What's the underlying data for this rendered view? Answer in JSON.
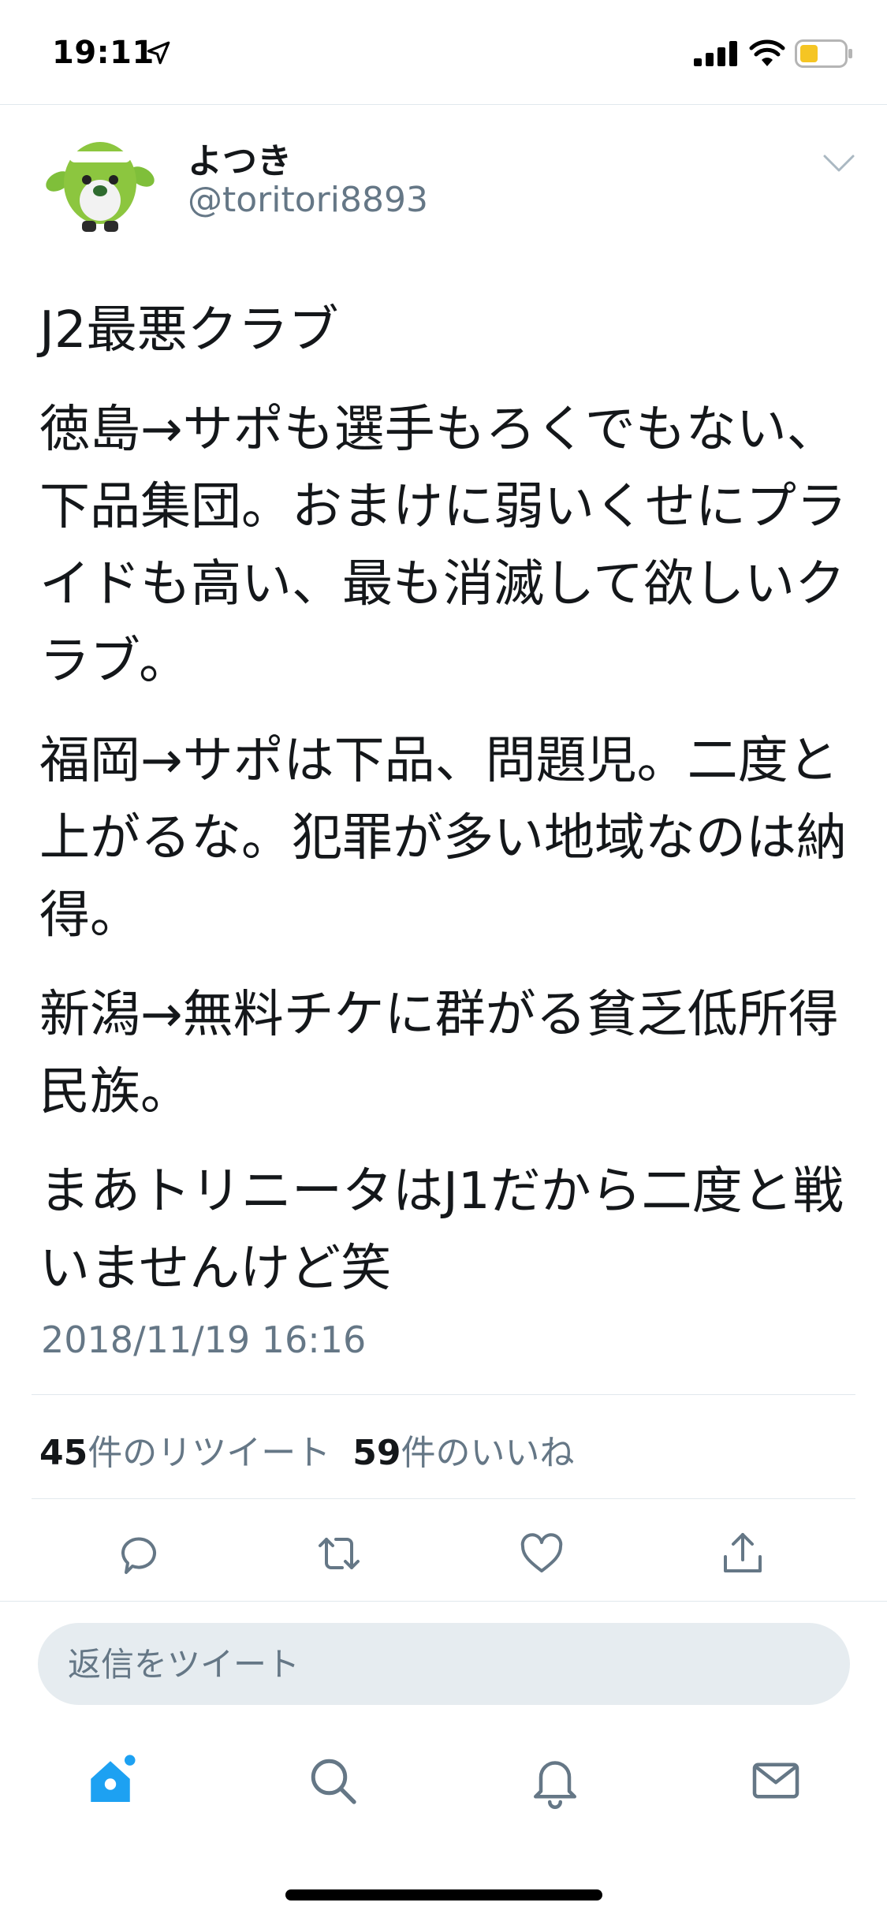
{
  "status_bar": {
    "time": "19:11",
    "icons": [
      "location-arrow-icon",
      "cellular-signal-icon",
      "wifi-icon",
      "battery-icon"
    ]
  },
  "tweet": {
    "display_name": "よつき",
    "handle": "@toritori8893",
    "paragraphs": [
      "J2最悪クラブ",
      "徳島→サポも選手もろくでもない、下品集団。おまけに弱いくせにプライドも高い、最も消滅して欲しいクラブ。",
      "福岡→サポは下品、問題児。二度と上がるな。犯罪が多い地域なのは納得。",
      "新潟→無料チケに群がる貧乏低所得民族。",
      "まあトリニータはJ1だから二度と戦いませんけど笑"
    ],
    "timestamp": "2018/11/19 16:16",
    "retweets": {
      "count": "45",
      "label": "件のリツイート"
    },
    "likes": {
      "count": "59",
      "label": "件のいいね"
    }
  },
  "actions": [
    "reply-icon",
    "retweet-icon",
    "like-icon",
    "share-icon"
  ],
  "reply": {
    "placeholder": "返信をツイート"
  },
  "tabbar": [
    "home-icon",
    "search-icon",
    "notifications-icon",
    "messages-icon"
  ],
  "colors": {
    "accent": "#1da1f2",
    "text": "#14171a",
    "secondary_text": "#657786",
    "divider": "#e1e8ed",
    "icon_gray": "#657786",
    "battery_level": "#f5c524"
  }
}
